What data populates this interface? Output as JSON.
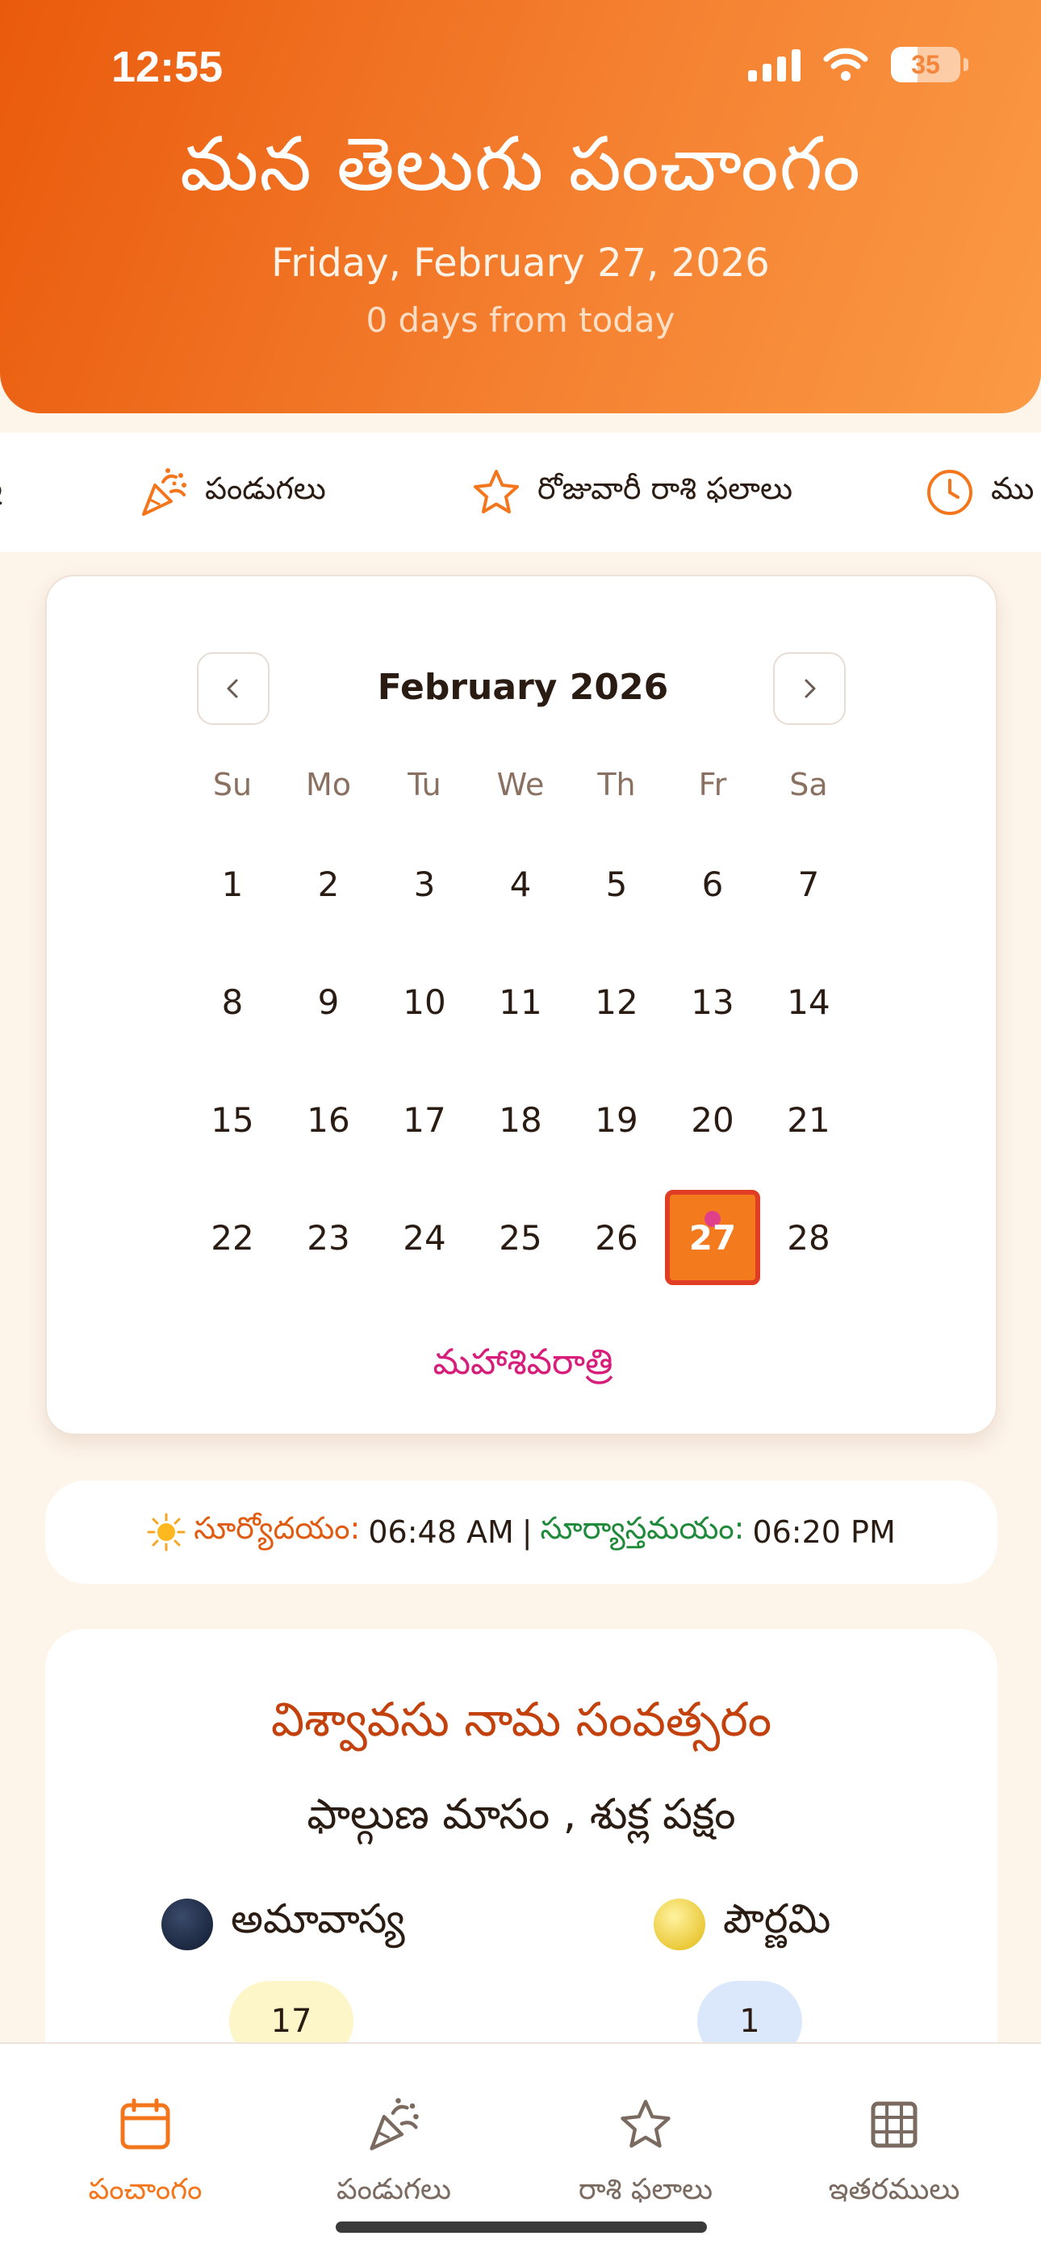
{
  "status_bar": {
    "time": "12:55",
    "battery": "35"
  },
  "header": {
    "title": "మన తెలుగు పంచాంగం",
    "date": "Friday, February 27, 2026",
    "days_from_today": "0 days from today"
  },
  "top_tabs": [
    {
      "label": "పండుగలు",
      "icon": "party-popper-icon"
    },
    {
      "label": "రోజువారీ రాశి ఫలాలు",
      "icon": "star-icon"
    },
    {
      "label": "ము",
      "icon": "clock-icon"
    }
  ],
  "calendar": {
    "month_title": "February 2026",
    "weekdays": [
      "Su",
      "Mo",
      "Tu",
      "We",
      "Th",
      "Fr",
      "Sa"
    ],
    "weeks": [
      [
        "1",
        "2",
        "3",
        "4",
        "5",
        "6",
        "7"
      ],
      [
        "8",
        "9",
        "10",
        "11",
        "12",
        "13",
        "14"
      ],
      [
        "15",
        "16",
        "17",
        "18",
        "19",
        "20",
        "21"
      ],
      [
        "22",
        "23",
        "24",
        "25",
        "26",
        "27",
        "28"
      ]
    ],
    "selected_day": "27",
    "festival": "మహాశివరాత్రి",
    "colors": {
      "selected_fill": "#f47a1e",
      "selected_border": "#e03e24",
      "festival_dot": "#e0408a"
    }
  },
  "sun_times": {
    "sunrise_label": "సూర్యోదయం:",
    "sunrise_time": "06:48 AM",
    "separator": "|",
    "sunset_label": "సూర్యాస్తమయం:",
    "sunset_time": "06:20 PM"
  },
  "year_info": {
    "samvatsaram": "విశ్వావసు నామ సంవత్సరం",
    "masam_paksham": "ఫాల్గుణ మాసం , శుక్ల పక్షం",
    "amavasya_label": "అమావాస్య",
    "amavasya_day": "17",
    "pournami_label": "పౌర్ణమి",
    "pournami_day": "1"
  },
  "bottom_nav": [
    {
      "label": "పంచాంగం",
      "icon": "calendar-icon",
      "active": true
    },
    {
      "label": "పండుగలు",
      "icon": "party-popper-icon",
      "active": false
    },
    {
      "label": "రాశి ఫలాలు",
      "icon": "star-icon",
      "active": false
    },
    {
      "label": "ఇతరములు",
      "icon": "grid-icon",
      "active": false
    }
  ],
  "theme": {
    "accent": "#f4761c",
    "header_start": "#ea5a0c",
    "header_end": "#fb9a45"
  }
}
